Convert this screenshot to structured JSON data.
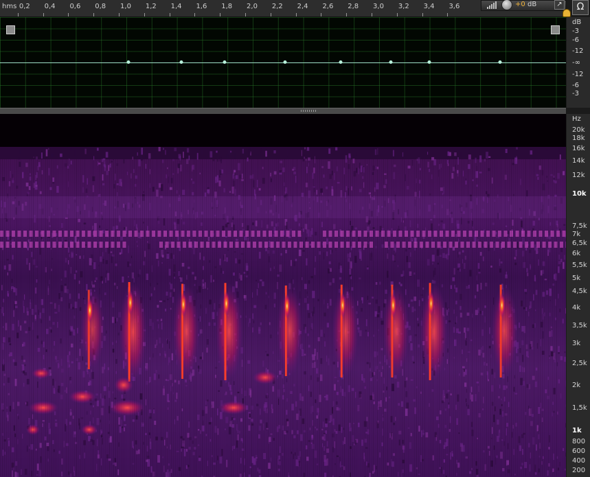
{
  "ruler": {
    "unit": "hms",
    "ticks": [
      "0,2",
      "0,4",
      "0,6",
      "0,8",
      "1,0",
      "1,2",
      "1,4",
      "1,6",
      "1,8",
      "2,0",
      "2,2",
      "2,4",
      "2,6",
      "2,8",
      "3,0",
      "3,2",
      "3,4",
      "3,6"
    ]
  },
  "controls": {
    "gain_value": "+0",
    "gain_unit": "dB",
    "expand_icon": "↗",
    "headphones_icon": "Ω"
  },
  "envelope": {
    "keyframe_times_s": [
      1.02,
      1.44,
      1.78,
      2.26,
      2.7,
      3.1,
      3.4,
      3.96
    ]
  },
  "db_scale": [
    "dB",
    "-3",
    "-6",
    "-12",
    "-∞",
    "-12",
    "-6",
    "-3"
  ],
  "hz_scale": [
    {
      "label": "Hz"
    },
    {
      "label": "20k"
    },
    {
      "label": "18k"
    },
    {
      "label": "16k"
    },
    {
      "label": "14k"
    },
    {
      "label": "12k"
    },
    {
      "label": "10k",
      "major": true
    },
    {
      "label": "7,5k"
    },
    {
      "label": "7k"
    },
    {
      "label": "6,5k"
    },
    {
      "label": "6k"
    },
    {
      "label": "5,5k"
    },
    {
      "label": "5k"
    },
    {
      "label": "4,5k"
    },
    {
      "label": "4k"
    },
    {
      "label": "3,5k"
    },
    {
      "label": "3k"
    },
    {
      "label": "2,5k"
    },
    {
      "label": "2k"
    },
    {
      "label": "1,5k"
    },
    {
      "label": "1k",
      "major": true
    },
    {
      "label": "800"
    },
    {
      "label": "600"
    },
    {
      "label": "400"
    },
    {
      "label": "200"
    }
  ],
  "colors": {
    "accent": "#e9b335",
    "envelope_line": "#9fe0c8",
    "grid": "#287828",
    "spectro_hot": "#ff5a1e",
    "spectro_mid": "#c3206a"
  },
  "calls": [
    {
      "t": 0.7,
      "strength": 0.55
    },
    {
      "t": 1.02,
      "strength": 1.0
    },
    {
      "t": 1.44,
      "strength": 0.9
    },
    {
      "t": 1.78,
      "strength": 0.95
    },
    {
      "t": 2.26,
      "strength": 0.8
    },
    {
      "t": 2.7,
      "strength": 0.85
    },
    {
      "t": 3.1,
      "strength": 0.85
    },
    {
      "t": 3.4,
      "strength": 0.95
    },
    {
      "t": 3.96,
      "strength": 0.85
    }
  ]
}
